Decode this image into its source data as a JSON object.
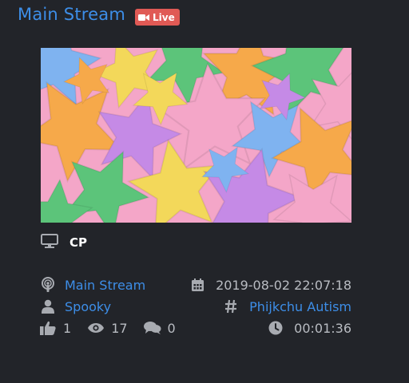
{
  "stream": {
    "title": "Main Stream",
    "live_label": "Live",
    "channel_name": "CP",
    "stream_name": "Main Stream",
    "user": "Spooky",
    "date": "2019-08-02 22:07:18",
    "tag": "Phijkchu Autism",
    "likes": "1",
    "views": "17",
    "comments": "0",
    "duration": "00:01:36"
  },
  "colors": {
    "background": "#222429",
    "link": "#3d8ee8",
    "live_badge": "#e05a55",
    "text": "#b9bcc2",
    "icon": "#a8abb1"
  },
  "icons": {
    "live": "video-camera-icon",
    "channel": "monitor-icon",
    "stream": "podcast-icon",
    "user": "user-icon",
    "date": "calendar-icon",
    "tag": "hashtag-icon",
    "likes": "thumbs-up-icon",
    "views": "eye-icon",
    "comments": "comments-icon",
    "duration": "clock-icon"
  }
}
